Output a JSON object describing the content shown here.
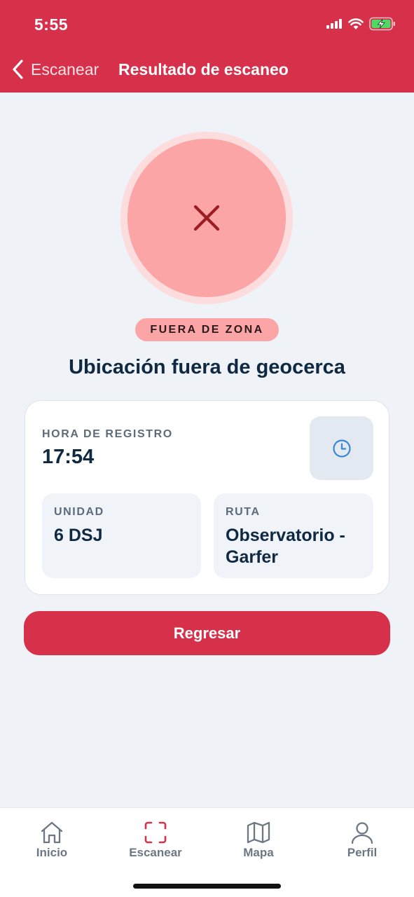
{
  "status_bar": {
    "time": "5:55"
  },
  "nav": {
    "back_label": "Escanear",
    "title": "Resultado de escaneo"
  },
  "result": {
    "badge": "FUERA DE ZONA",
    "title": "Ubicación fuera de geocerca",
    "icon": "close-icon"
  },
  "card": {
    "hora_label": "HORA DE REGISTRO",
    "hora_value": "17:54",
    "unidad_label": "UNIDAD",
    "unidad_value": "6 DSJ",
    "ruta_label": "RUTA",
    "ruta_value": "Observatorio - Garfer"
  },
  "actions": {
    "primary": "Regresar"
  },
  "tabs": [
    {
      "label": "Inicio",
      "icon": "home-icon"
    },
    {
      "label": "Escanear",
      "icon": "scan-icon"
    },
    {
      "label": "Mapa",
      "icon": "map-icon"
    },
    {
      "label": "Perfil",
      "icon": "user-icon"
    }
  ],
  "colors": {
    "brand": "#d7304a",
    "error_fill": "#fba5a6",
    "error_ring": "#fcdcdd",
    "error_icon": "#9c1c24",
    "background": "#eff2f7",
    "accent_blue": "#3b86d9"
  }
}
